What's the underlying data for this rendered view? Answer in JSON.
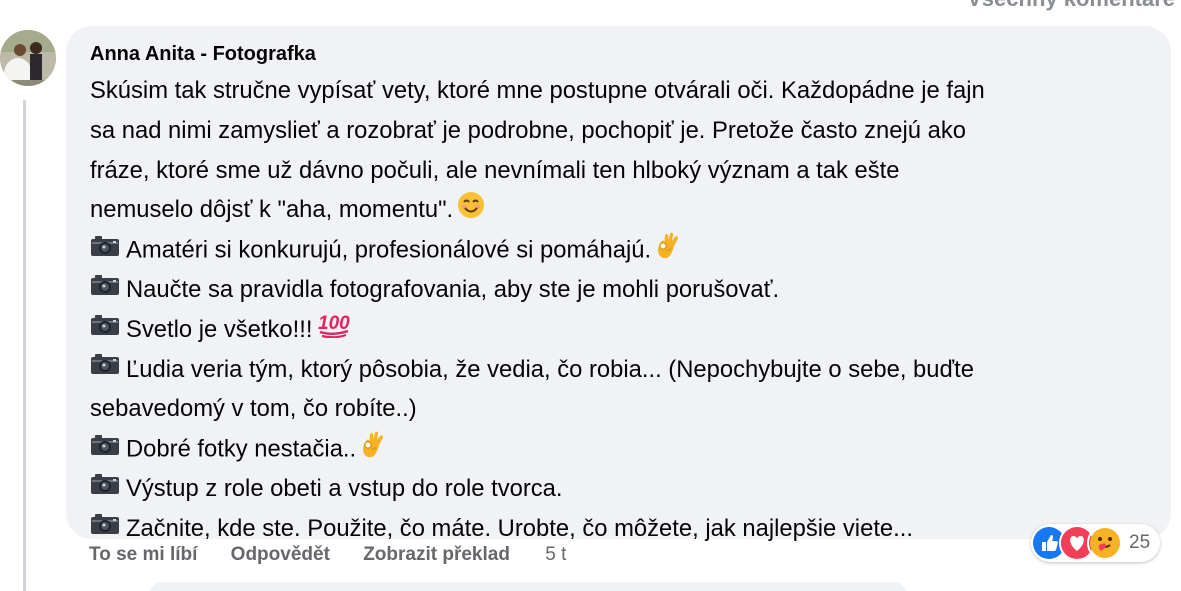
{
  "top_partial_text": "Všechny komentáře",
  "comment": {
    "author": "Anna Anita - Fotografka",
    "lines": [
      {
        "text": "Skúsim tak stručne vypísať vety, ktoré mne postupne otvárali oči. Každopádne je fajn"
      },
      {
        "text": "sa nad nimi zamyslieť a rozobrať je podrobne, pochopiť je. Pretože často znejú ako"
      },
      {
        "text": "fráze, ktoré sme už dávno počuli, ale nevnímali ten hlboký význam a tak ešte"
      },
      {
        "text": "nemuselo dôjsť k \"aha, momentu\".",
        "emoji": "smiling-face-emoji"
      },
      {
        "text": "Amatéri si konkurujú, profesionálové si pomáhajú.",
        "camera": true,
        "emoji": "ok-hand-emoji"
      },
      {
        "text": "Naučte sa pravidla fotografovania, aby ste je mohli porušovať.",
        "camera": true
      },
      {
        "text": "Svetlo je všetko!!!",
        "camera": true,
        "emoji": "hundred-points-emoji"
      },
      {
        "text": "Ľudia veria tým, ktorý pôsobia, že vedia, čo robia... (Nepochybujte o sebe, buďte",
        "camera": true
      },
      {
        "text": "sebavedomý v tom, čo robíte..)"
      },
      {
        "text": "Dobré fotky nestačia..",
        "camera": true,
        "emoji": "ok-hand-emoji"
      },
      {
        "text": "Výstup z role obeti a vstup do role tvorca.",
        "camera": true
      },
      {
        "text": "Začnite, kde ste. Použite, čo máte. Urobte, čo môžete, jak najlepšie viete...",
        "camera": true
      }
    ]
  },
  "actions": {
    "like": "To se mi líbí",
    "reply": "Odpovědět",
    "translate": "Zobrazit překlad",
    "time": "5 t"
  },
  "reactions": {
    "icons": [
      "like-icon",
      "love-icon",
      "care-icon"
    ],
    "count": "25",
    "colors": {
      "like": "#1877f2",
      "love": "#f33e58",
      "care": "#f7b125"
    }
  },
  "colors": {
    "bubble": "#f0f2f5",
    "text": "#050505",
    "secondary": "#65676b"
  }
}
